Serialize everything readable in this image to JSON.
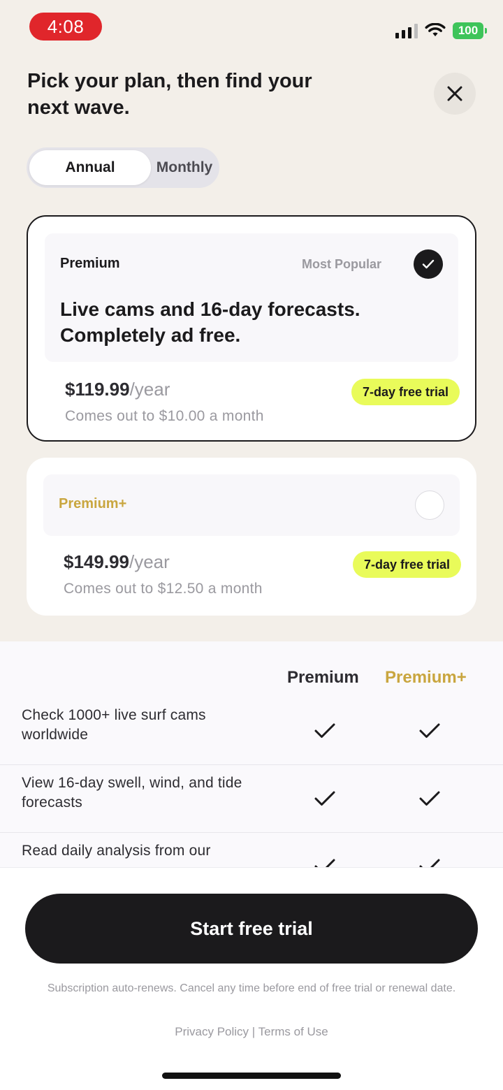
{
  "status_bar": {
    "time": "4:08",
    "battery": "100"
  },
  "header": {
    "title": "Pick your plan, then find your next wave."
  },
  "billing_toggle": {
    "options": [
      "Annual",
      "Monthly"
    ],
    "selected": "Annual"
  },
  "plans": [
    {
      "name": "Premium",
      "badge": "Most Popular",
      "selected": true,
      "description": "Live cams and 16-day forecasts. Completely ad free.",
      "price": "$119.99",
      "period": "/year",
      "monthly_note": "Comes out to $10.00 a month",
      "trial": "7-day free trial"
    },
    {
      "name": "Premium+",
      "selected": false,
      "price": "$149.99",
      "period": "/year",
      "monthly_note": "Comes out to $12.50 a month",
      "trial": "7-day free trial"
    }
  ],
  "comparison": {
    "columns": [
      "Premium",
      "Premium+"
    ],
    "rows": [
      {
        "feature": "Check 1000+ live surf cams worldwide",
        "premium": true,
        "premium_plus": true
      },
      {
        "feature": "View 16-day swell, wind, and tide forecasts",
        "premium": true,
        "premium_plus": true
      },
      {
        "feature": "Read daily analysis from our",
        "premium": true,
        "premium_plus": true
      }
    ]
  },
  "footer": {
    "cta": "Start free trial",
    "disclaimer": "Subscription auto-renews. Cancel any time before end of free trial or renewal date.",
    "privacy": "Privacy Policy",
    "separator": "|",
    "terms": "Terms of Use"
  },
  "colors": {
    "accent_gold": "#c9a63f",
    "trial_badge": "#e9fb5a",
    "time_pill": "#e0262b",
    "primary": "#1b1a1c"
  }
}
